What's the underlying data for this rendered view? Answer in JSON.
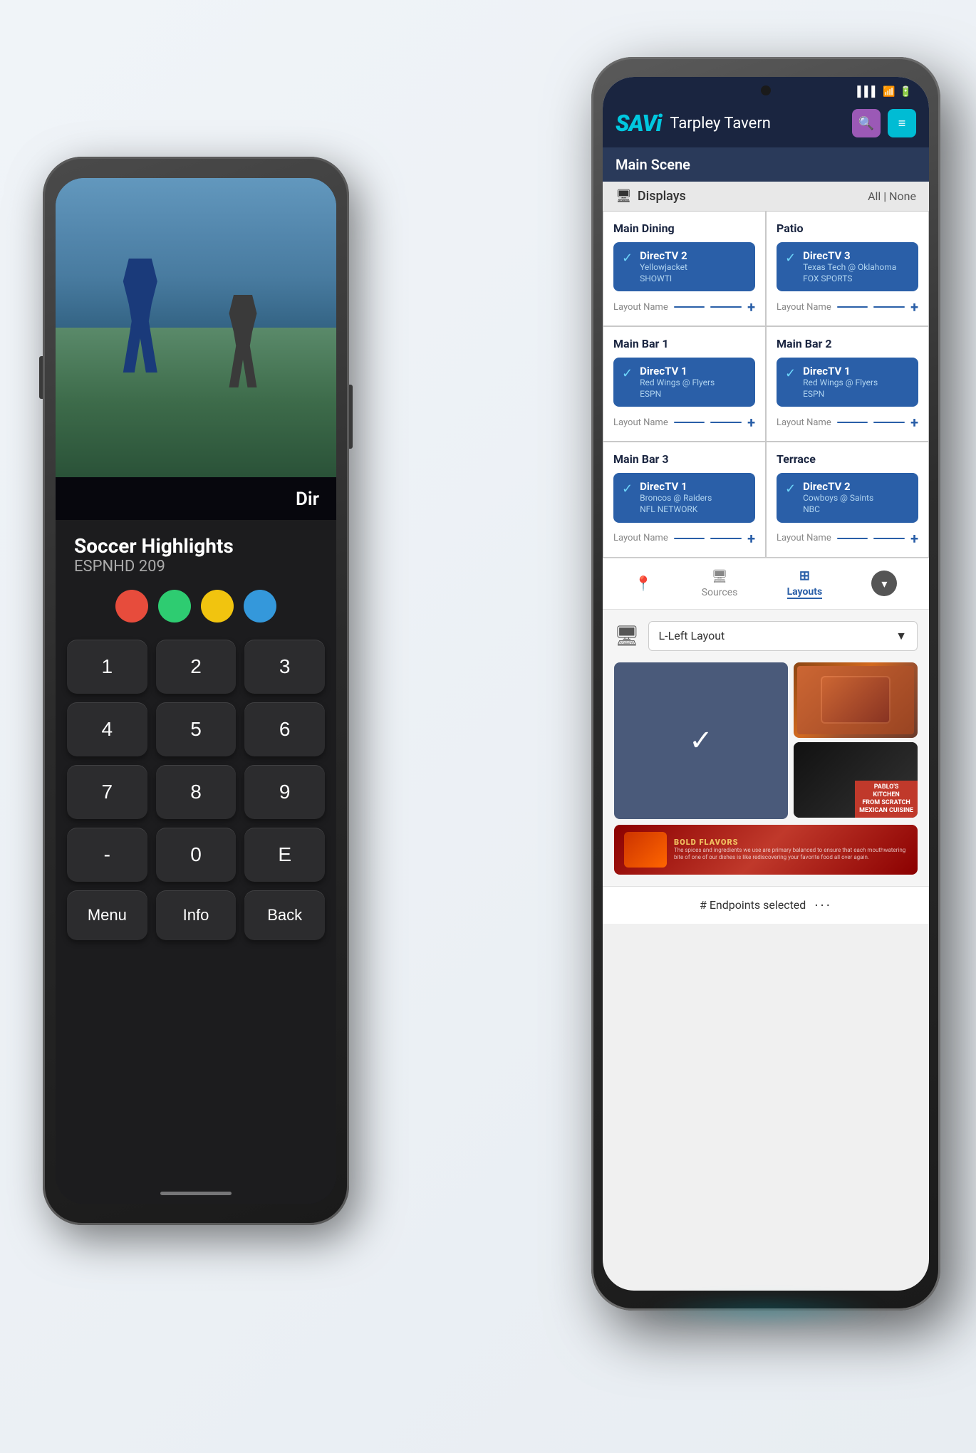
{
  "scene": {
    "background": "#f0f4f8"
  },
  "back_phone": {
    "soccer_channel": "Soccer Highlights",
    "channel_number": "ESPNHD 209",
    "directv_label": "Dir",
    "color_buttons": [
      "red",
      "green",
      "yellow",
      "blue"
    ],
    "numpad": [
      "1",
      "2",
      "3",
      "4",
      "5",
      "6",
      "7",
      "8",
      "9",
      "-",
      "0",
      "E"
    ],
    "bottom_buttons": [
      "Menu",
      "Info",
      "Back"
    ]
  },
  "front_phone": {
    "logo": "SAVi",
    "venue": "Tarpley Tavern",
    "header_icons": {
      "search": "🔍",
      "menu": "≡"
    },
    "scene_name": "Main Scene",
    "displays_section": {
      "label": "Displays",
      "all_none": "All | None",
      "cells": [
        {
          "zone": "Main Dining",
          "source": "DirecTV 2",
          "detail": "Yellowjacket\nSHOWTI",
          "layout": "Layout Name"
        },
        {
          "zone": "Patio",
          "source": "DirecTV 3",
          "detail": "Texas Tech @ Oklahoma\nFOX SPORTS",
          "layout": "Layout Name"
        },
        {
          "zone": "Main Bar 1",
          "source": "DirecTV 1",
          "detail": "Red Wings @ Flyers\nESPN",
          "layout": "Layout Name"
        },
        {
          "zone": "Main Bar 2",
          "source": "DirecTV 1",
          "detail": "Red Wings @ Flyers\nESPN",
          "layout": "Layout Name"
        },
        {
          "zone": "Main Bar 3",
          "source": "DirecTV 1",
          "detail": "Broncos @ Raiders\nNFL NETWORK",
          "layout": "Layout Name"
        },
        {
          "zone": "Terrace",
          "source": "DirecTV 2",
          "detail": "Cowboys @ Saints\nNBC",
          "layout": "Layout Name"
        }
      ]
    },
    "bottom_nav": {
      "location_icon": "📍",
      "sources_label": "Sources",
      "layouts_label": "Layouts",
      "down_icon": "▾"
    },
    "layouts_section": {
      "layout_name": "L-Left Layout",
      "dropdown_arrow": "▼"
    },
    "banner": {
      "title": "BOLD FLAVORS",
      "subtitle": "The spices and ingredients we use are primary balanced to ensure that each mouthwatering bite of one of our dishes is like rediscovering your favorite food all over again."
    },
    "endpoints": {
      "label": "# Endpoints selected",
      "dots": "..."
    },
    "food_label": "PABLO'S\nKITCHEN\nFROM SCRATCH MEXICAN CUISINE"
  }
}
